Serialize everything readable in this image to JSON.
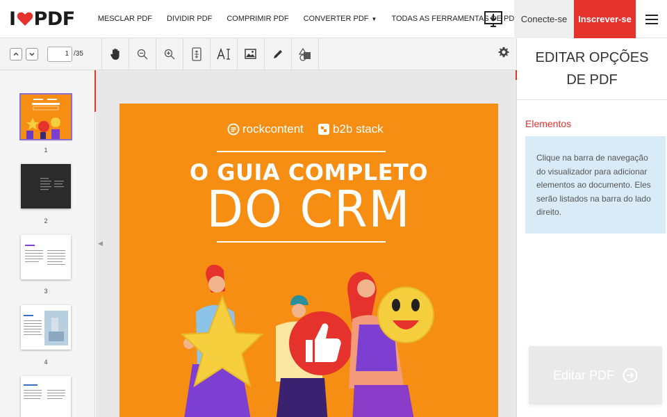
{
  "app": {
    "logo_left": "I",
    "logo_right": "PDF",
    "brand_color": "#e5322d"
  },
  "nav": {
    "links": [
      {
        "label": "MESCLAR PDF",
        "caret": ""
      },
      {
        "label": "DIVIDIR PDF",
        "caret": ""
      },
      {
        "label": "COMPRIMIR PDF",
        "caret": ""
      },
      {
        "label": "CONVERTER PDF",
        "caret": "▼"
      },
      {
        "label": "TODAS AS FERRAMENTAS DE PDF",
        "caret": "▼"
      }
    ],
    "login_label": "Conecte-se",
    "signup_label": "Inscrever-se"
  },
  "toolbar": {
    "current_page": "1",
    "total_pages": "/35"
  },
  "thumbnails": [
    {
      "num": "1"
    },
    {
      "num": "2"
    },
    {
      "num": "3"
    },
    {
      "num": "4"
    },
    {
      "num": ""
    }
  ],
  "document": {
    "brand1": "rockcontent",
    "brand2": "b2b stack",
    "title_line1": "O GUIA COMPLETO",
    "title_line2": "DO CRM",
    "background": "#f58e12"
  },
  "panel": {
    "title": "EDITAR OPÇÕES DE PDF",
    "section_title": "Elementos",
    "info_text": "Clique na barra de navegação do visualizador para adicionar elementos ao documento. Eles serão listados na barra do lado direito.",
    "edit_button_label": "Editar PDF"
  }
}
